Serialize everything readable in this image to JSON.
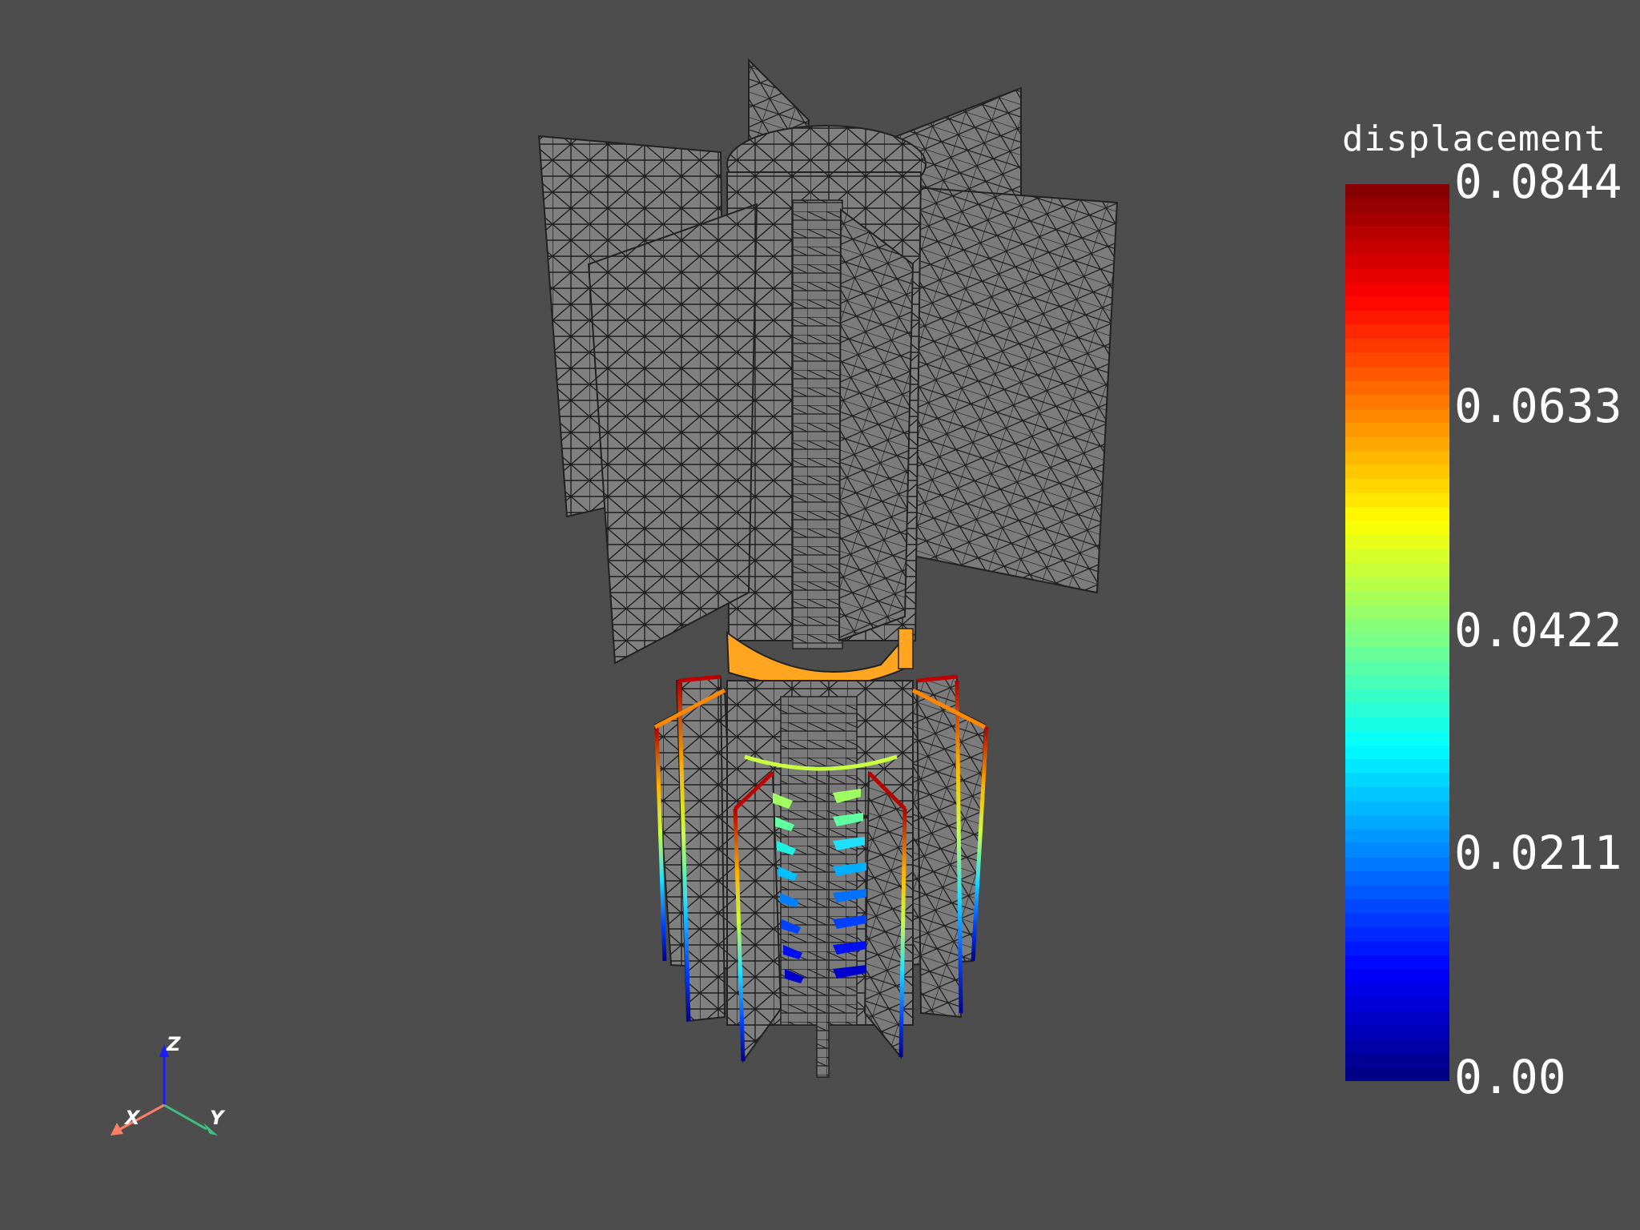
{
  "scalar_bar": {
    "title": "displacement",
    "ticks": [
      "0.0844",
      "0.0633",
      "0.0422",
      "0.0211",
      "0.00"
    ],
    "colormap": [
      "#00007f",
      "#0000ff",
      "#0080ff",
      "#00ffff",
      "#80ff80",
      "#ffff00",
      "#ff8000",
      "#ff0000",
      "#7f0000"
    ],
    "bands": 64
  },
  "axes_widget": {
    "x_label": "X",
    "y_label": "Y",
    "z_label": "Z",
    "x_color": "#ff7f66",
    "y_color": "#3dbf7f",
    "z_color": "#1a1aff"
  },
  "scene": {
    "background": "#4d4d4d",
    "surface_color": "#808080",
    "edge_color": "#000000",
    "ring_color": "#ffa520"
  }
}
